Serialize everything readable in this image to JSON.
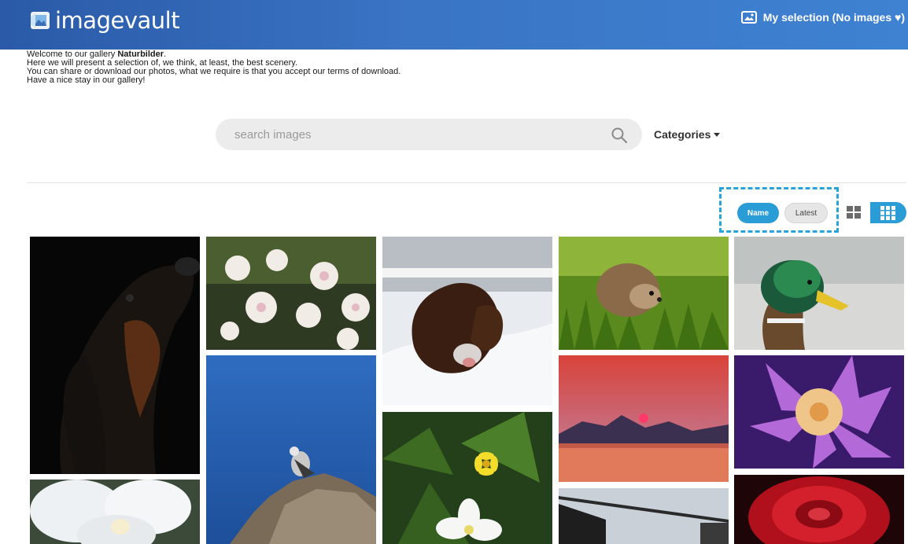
{
  "header": {
    "logo_text": "imagevault",
    "selection_label": "My selection (No images ♥)"
  },
  "welcome": {
    "line1_prefix": "Welcome to our gallery ",
    "gallery_name": "Naturbilder",
    "line1_suffix": ".",
    "line2": "Here we will present a selection of, we think, at least, the best scenery.",
    "line3": "You can share or download our photos, what we require is that you accept our terms of download.",
    "line4": "Have a nice stay in our gallery!"
  },
  "search": {
    "placeholder": "search images",
    "value": ""
  },
  "categories": {
    "label": "Categories"
  },
  "sort": {
    "options": [
      "Name",
      "Latest"
    ],
    "selected": "Name"
  },
  "view": {
    "selected": "small-grid"
  },
  "colors": {
    "header_start": "#2a5aa8",
    "header_end": "#3f82d2",
    "accent": "#2b9dd6",
    "highlight_dash": "#2aa3dc"
  },
  "gallery": [
    {
      "icon": "dog-portrait-image"
    },
    {
      "icon": "white-orchid-image"
    },
    {
      "icon": "apple-blossom-image"
    },
    {
      "icon": "seagull-on-rock-image"
    },
    {
      "icon": "spaniel-in-snow-image"
    },
    {
      "icon": "yellow-and-white-flowers-image"
    },
    {
      "icon": "hedgehog-in-grass-image"
    },
    {
      "icon": "sunset-over-lake-image"
    },
    {
      "icon": "building-silhouette-image"
    },
    {
      "icon": "mallard-duck-image"
    },
    {
      "icon": "purple-flower-image"
    },
    {
      "icon": "red-rose-image"
    }
  ]
}
